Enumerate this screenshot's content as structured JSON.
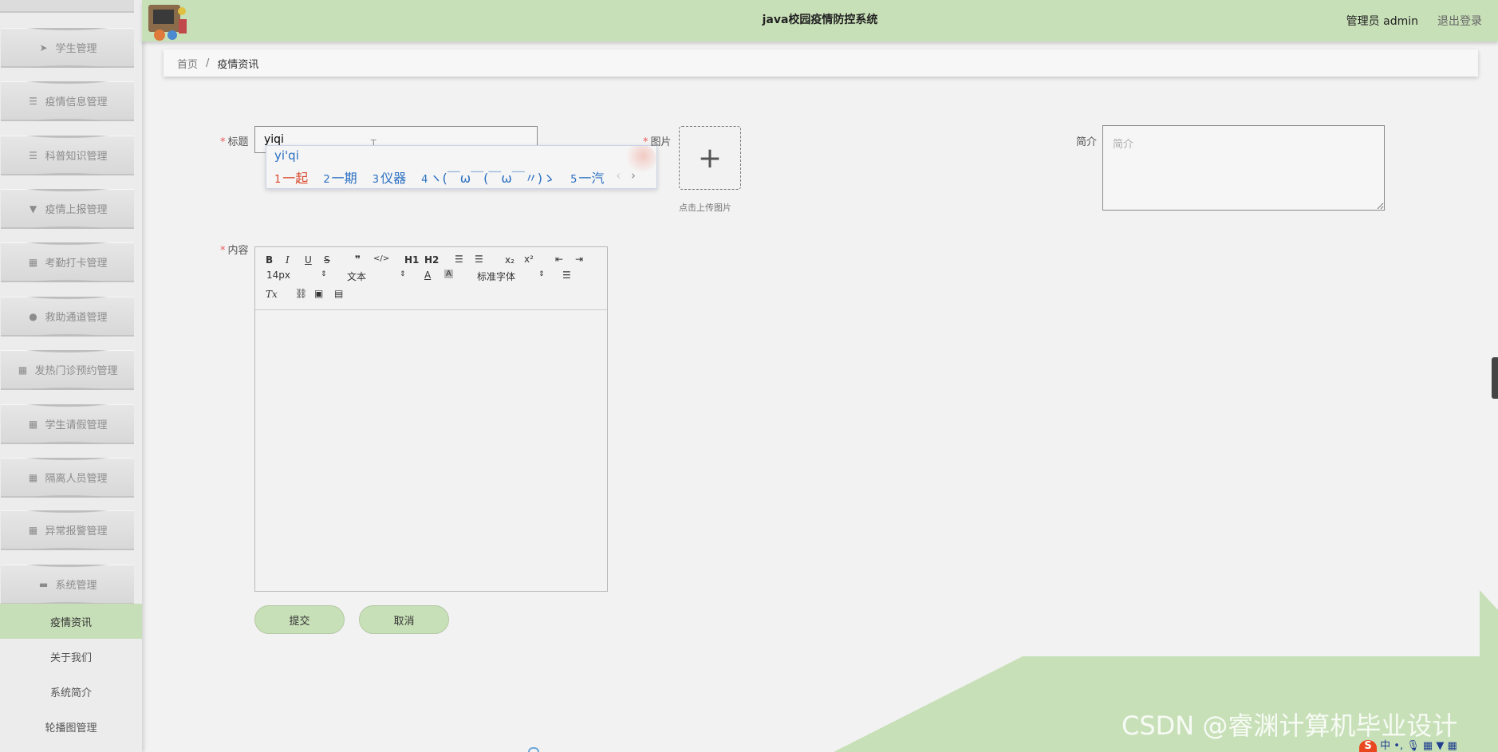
{
  "header": {
    "title": "java校园疫情防控系统",
    "user": "管理员 admin",
    "logout": "退出登录"
  },
  "sidebar": {
    "menus": [
      {
        "label": "学生管理",
        "icon": "send-icon"
      },
      {
        "label": "疫情信息管理",
        "icon": "list-icon"
      },
      {
        "label": "科普知识管理",
        "icon": "list-icon"
      },
      {
        "label": "疫情上报管理",
        "icon": "clipboard-icon"
      },
      {
        "label": "考勤打卡管理",
        "icon": "grid-icon"
      },
      {
        "label": "救助通道管理",
        "icon": "location-icon"
      },
      {
        "label": "发热门诊预约管理",
        "icon": "grid-icon"
      },
      {
        "label": "学生请假管理",
        "icon": "grid-icon"
      },
      {
        "label": "隔离人员管理",
        "icon": "grid-icon"
      },
      {
        "label": "异常报警管理",
        "icon": "grid-icon"
      },
      {
        "label": "系统管理",
        "icon": "monitor-icon"
      }
    ],
    "submenu": [
      "疫情资讯",
      "关于我们",
      "系统简介",
      "轮播图管理"
    ]
  },
  "breadcrumb": {
    "home": "首页",
    "sep": "/",
    "current": "疫情资讯"
  },
  "form": {
    "title_label": "标题",
    "title_value": "yiqi",
    "image_label": "图片",
    "upload_tip": "点击上传图片",
    "brief_label": "简介",
    "brief_placeholder": "简介",
    "content_label": "内容",
    "required_mark": "*",
    "submit": "提交",
    "cancel": "取消"
  },
  "ime": {
    "composition": "yi'qi",
    "candidates": [
      {
        "num": "1",
        "text": "一起"
      },
      {
        "num": "2",
        "text": "一期"
      },
      {
        "num": "3",
        "text": "仪器"
      },
      {
        "num": "4",
        "text": "ヽ(￣ω￣(￣ω￣〃)ゝ"
      },
      {
        "num": "5",
        "text": "一汽"
      }
    ],
    "prev": "‹",
    "next": "›"
  },
  "editor": {
    "font_size": "14px",
    "block_format": "文本",
    "font_family": "标准字体",
    "sub_label": "x₂",
    "sup_label": "x²",
    "h1_label": "H1",
    "h2_label": "H2",
    "clear_label": "Tx"
  },
  "watermark": "CSDN @睿渊计算机毕业设计",
  "ime_bar": {
    "logo": "S",
    "lang": "中"
  }
}
